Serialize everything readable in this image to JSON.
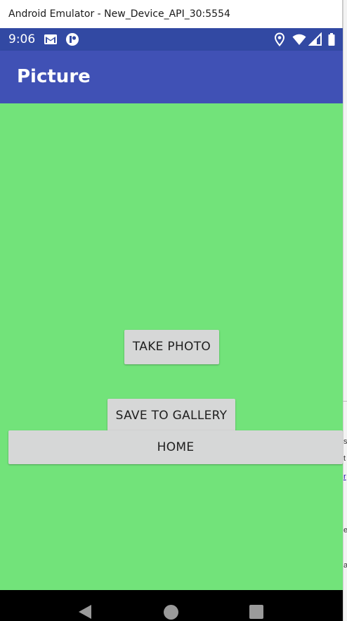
{
  "window": {
    "title": "Android Emulator - New_Device_API_30:5554"
  },
  "status_bar": {
    "time": "9:06",
    "left_icons": [
      "gmail-icon",
      "app-notification-icon"
    ],
    "right_icons": [
      "location-icon",
      "wifi-icon",
      "signal-icon",
      "battery-icon"
    ]
  },
  "app_bar": {
    "title": "Picture"
  },
  "buttons": {
    "take_photo": "TAKE PHOTO",
    "save_to_gallery": "SAVE TO GALLERY",
    "home": "HOME"
  },
  "nav_bar": {
    "icons": [
      "back-icon",
      "home-icon",
      "recents-icon"
    ]
  },
  "background_window": {
    "fragments": [
      "s",
      "t",
      "r",
      "e",
      "a"
    ]
  },
  "colors": {
    "status_bar": "#3249a3",
    "app_bar": "#4051b5",
    "content_background": "#72e37a",
    "button": "#d6d7d7",
    "nav_bar": "#000000"
  }
}
